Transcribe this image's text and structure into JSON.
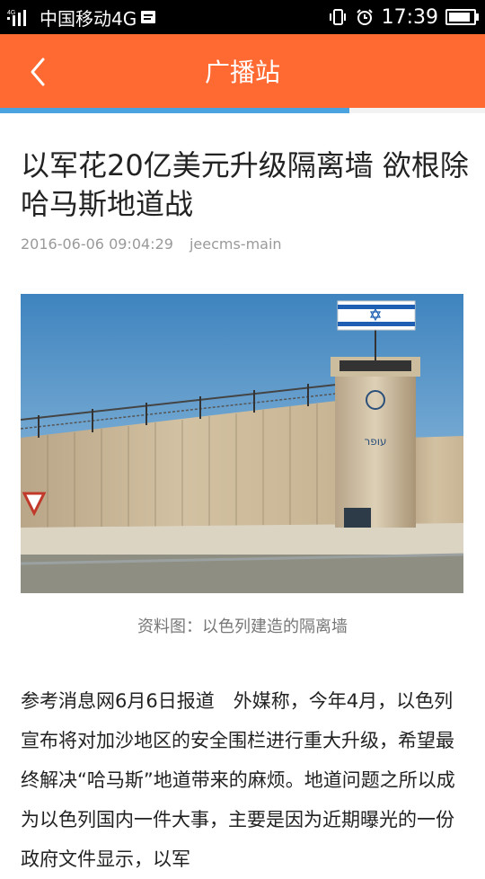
{
  "status_bar": {
    "network_badge": "4G",
    "carrier": "中国移动4G",
    "time": "17:39",
    "icons": [
      "signal-icon",
      "sim-icon",
      "vibrate-icon",
      "alarm-icon",
      "battery-icon"
    ],
    "battery_level": 0.9
  },
  "header": {
    "title": "广播站",
    "back_icon": "chevron-left-icon",
    "color": "#ff6a33"
  },
  "load_progress": 0.72,
  "article": {
    "title": "以军花20亿美元升级隔离墙 欲根除哈马斯地道战",
    "date": "2016-06-06 09:04:29",
    "source": "jeecms-main",
    "caption": "资料图：以色列建造的隔离墙",
    "body": "参考消息网6月6日报道　外媒称，今年4月，以色列宣布将对加沙地区的安全围栏进行重大升级，希望最终解决“哈马斯”地道带来的麻烦。地道问题之所以成为以色列国内一件大事，主要是因为近期曝光的一份政府文件显示，以军"
  },
  "photo": {
    "tower_sign": "עופר"
  }
}
